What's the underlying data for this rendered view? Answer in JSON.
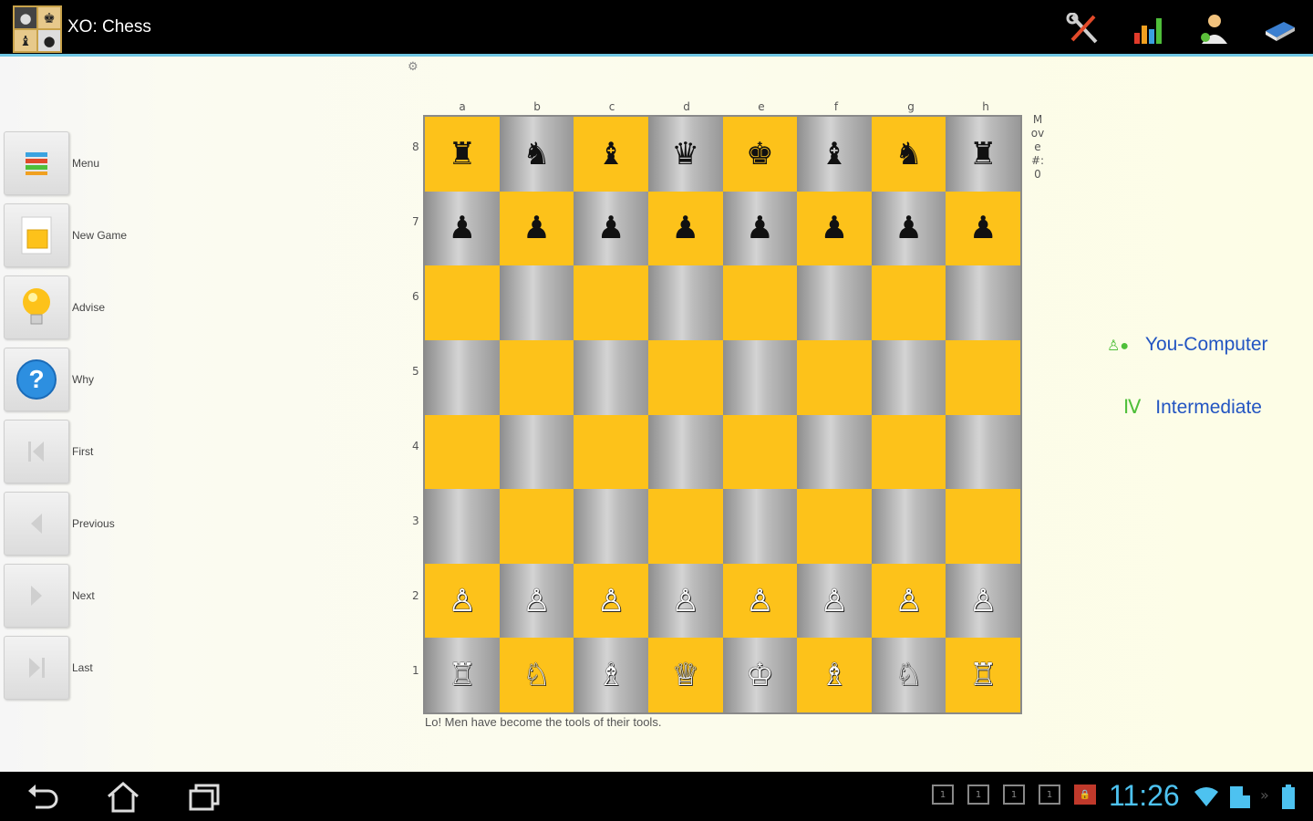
{
  "app": {
    "title": "XO: Chess",
    "icon_pieces": [
      "●",
      "♚",
      "♝",
      "●"
    ]
  },
  "actionbar": {
    "buttons": [
      {
        "name": "tools-icon"
      },
      {
        "name": "stats-chart-icon"
      },
      {
        "name": "players-icon"
      },
      {
        "name": "book-icon"
      }
    ]
  },
  "sidebar": {
    "items": [
      {
        "label": "Menu",
        "icon": "menu-list-icon"
      },
      {
        "label": "New Game",
        "icon": "new-game-icon"
      },
      {
        "label": "Advise",
        "icon": "lightbulb-icon"
      },
      {
        "label": "Why",
        "icon": "question-icon"
      },
      {
        "label": "First",
        "icon": "first-icon"
      },
      {
        "label": "Previous",
        "icon": "previous-icon"
      },
      {
        "label": "Next",
        "icon": "next-icon"
      },
      {
        "label": "Last",
        "icon": "last-icon"
      }
    ]
  },
  "board": {
    "files": [
      "a",
      "b",
      "c",
      "d",
      "e",
      "f",
      "g",
      "h"
    ],
    "ranks": [
      "8",
      "7",
      "6",
      "5",
      "4",
      "3",
      "2",
      "1"
    ],
    "squares": [
      [
        "♜",
        "♞",
        "♝",
        "♛",
        "♚",
        "♝",
        "♞",
        "♜"
      ],
      [
        "♟",
        "♟",
        "♟",
        "♟",
        "♟",
        "♟",
        "♟",
        "♟"
      ],
      [
        "",
        "",
        "",
        "",
        "",
        "",
        "",
        ""
      ],
      [
        "",
        "",
        "",
        "",
        "",
        "",
        "",
        ""
      ],
      [
        "",
        "",
        "",
        "",
        "",
        "",
        "",
        ""
      ],
      [
        "",
        "",
        "",
        "",
        "",
        "",
        "",
        ""
      ],
      [
        "♙",
        "♙",
        "♙",
        "♙",
        "♙",
        "♙",
        "♙",
        "♙"
      ],
      [
        "♖",
        "♘",
        "♗",
        "♕",
        "♔",
        "♗",
        "♘",
        "♖"
      ]
    ],
    "colors": {
      "light": "#fdc21a",
      "dark": "#a8a8a8"
    }
  },
  "move_label": "Move #: 0",
  "quote": "Lo! Men have become the tools of their tools.",
  "info": {
    "mode": "You-Computer",
    "level": "Intermediate",
    "level_glyph": "Ⅳ"
  },
  "status": {
    "time": "11:26"
  }
}
